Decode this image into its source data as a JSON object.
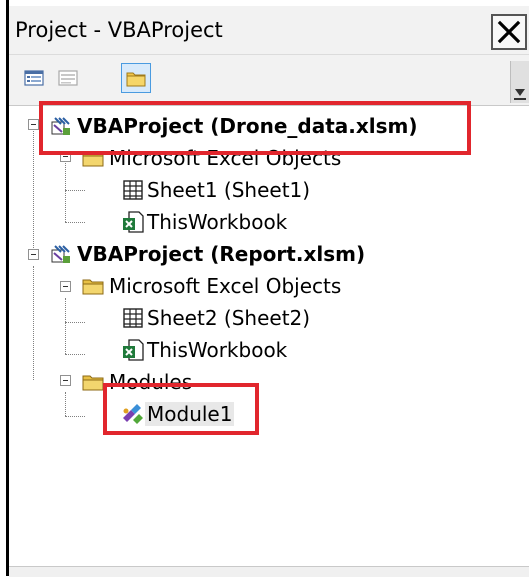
{
  "window": {
    "title": "Project - VBAProject",
    "close_glyph": "✕"
  },
  "toolbar": {
    "buttons": [
      {
        "name": "view-code-icon",
        "active": false
      },
      {
        "name": "view-object-icon",
        "active": false
      },
      {
        "name": "toggle-folders-icon",
        "active": true
      }
    ]
  },
  "tree": {
    "nodes": [
      {
        "label": "VBAProject (Drone_data.xlsm)",
        "icon": "vba-project-icon",
        "bold": true
      },
      {
        "label": "Microsoft Excel Objects",
        "icon": "folder-icon"
      },
      {
        "label": "Sheet1 (Sheet1)",
        "icon": "worksheet-icon"
      },
      {
        "label": "ThisWorkbook",
        "icon": "workbook-icon"
      },
      {
        "label": "VBAProject (Report.xlsm)",
        "icon": "vba-project-icon",
        "bold": true
      },
      {
        "label": "Microsoft Excel Objects",
        "icon": "folder-icon"
      },
      {
        "label": "Sheet2 (Sheet2)",
        "icon": "worksheet-icon"
      },
      {
        "label": "ThisWorkbook",
        "icon": "workbook-icon"
      },
      {
        "label": "Modules",
        "icon": "folder-icon"
      },
      {
        "label": "Module1",
        "icon": "module-icon",
        "selected": true
      }
    ]
  },
  "annotations": {
    "highlight_color": "#e1262d"
  }
}
